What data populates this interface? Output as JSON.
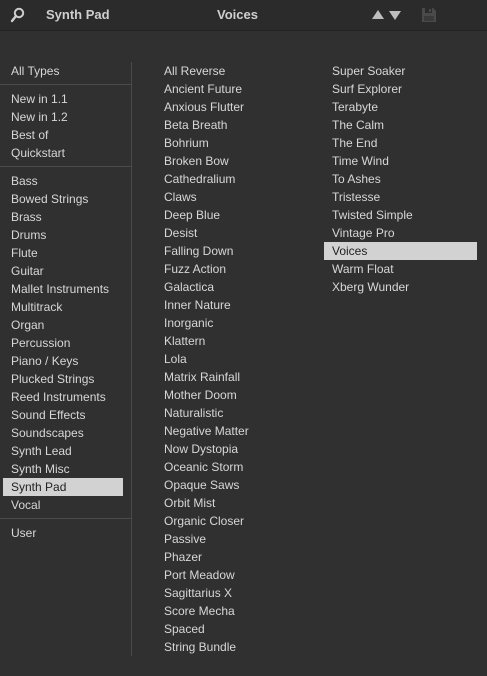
{
  "header": {
    "category": "Synth Pad",
    "preset": "Voices",
    "icons": {
      "search": "search-icon",
      "prev": "arrow-up-icon",
      "next": "arrow-down-icon",
      "save": "save-icon"
    }
  },
  "types": {
    "all": "All Types",
    "special": [
      "New in 1.1",
      "New in 1.2",
      "Best of",
      "Quickstart"
    ],
    "categories": [
      "Bass",
      "Bowed Strings",
      "Brass",
      "Drums",
      "Flute",
      "Guitar",
      "Mallet Instruments",
      "Multitrack",
      "Organ",
      "Percussion",
      "Piano / Keys",
      "Plucked Strings",
      "Reed Instruments",
      "Sound Effects",
      "Soundscapes",
      "Synth Lead",
      "Synth Misc",
      "Synth Pad",
      "Vocal"
    ],
    "selected_category_index": 17,
    "user": "User"
  },
  "presets": {
    "column1": [
      "All Reverse",
      "Ancient Future",
      "Anxious Flutter",
      "Beta Breath",
      "Bohrium",
      "Broken Bow",
      "Cathedralium",
      "Claws",
      "Deep Blue",
      "Desist",
      "Falling Down",
      "Fuzz Action",
      "Galactica",
      "Inner Nature",
      "Inorganic",
      "Klattern",
      "Lola",
      "Matrix Rainfall",
      "Mother Doom",
      "Naturalistic",
      "Negative Matter",
      "Now Dystopia",
      "Oceanic Storm",
      "Opaque Saws",
      "Orbit Mist",
      "Organic Closer",
      "Passive",
      "Phazer",
      "Port Meadow",
      "Sagittarius X",
      "Score Mecha",
      "Spaced",
      "String Bundle"
    ],
    "column2": [
      "Super Soaker",
      "Surf Explorer",
      "Terabyte",
      "The Calm",
      "The End",
      "Time Wind",
      "To Ashes",
      "Tristesse",
      "Twisted Simple",
      "Vintage Pro",
      "Voices",
      "Warm Float",
      "Xberg Wunder"
    ],
    "selected_preset_index_column2": 10
  },
  "colors": {
    "background": "#303030",
    "selection": "#d2d2d2",
    "text": "#d7d7d7"
  }
}
